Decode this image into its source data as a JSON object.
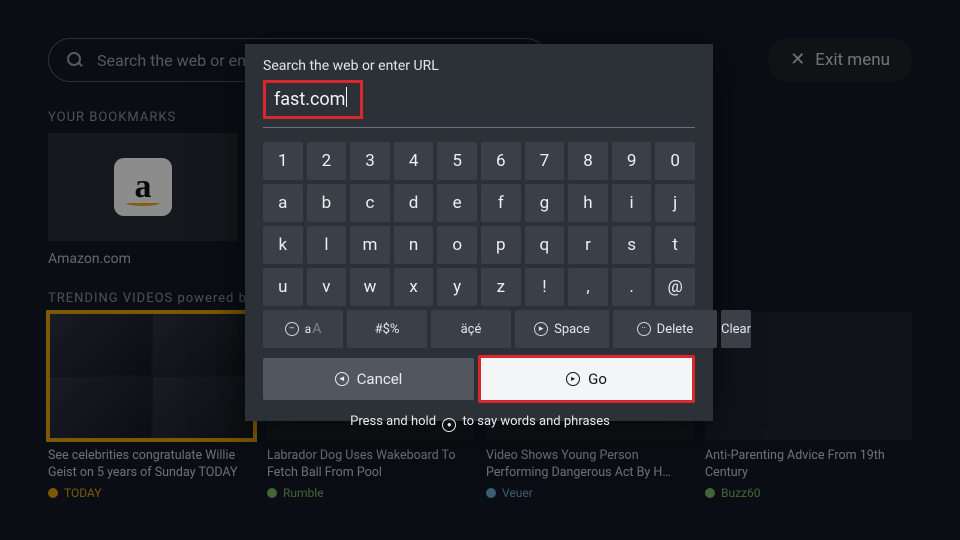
{
  "searchbar": {
    "placeholder": "Search the web or enter URL"
  },
  "exit": {
    "label": "Exit menu"
  },
  "sections": {
    "bookmarks_label": "YOUR BOOKMARKS",
    "trending_label": "TRENDING VIDEOS powered by"
  },
  "bookmarks": [
    {
      "label": "Amazon.com"
    }
  ],
  "trending": [
    {
      "title": "See celebrities congratulate Willie Geist on 5 years of Sunday TODAY",
      "source": "TODAY",
      "color": "#e0a008",
      "highlight": true
    },
    {
      "title": "Labrador Dog Uses Wakeboard To Fetch Ball From Pool",
      "source": "Rumble",
      "color": "#7bb661"
    },
    {
      "title": "Video Shows Young Person Performing Dangerous Act By H…",
      "source": "Veuer",
      "color": "#6aa7d6"
    },
    {
      "title": "Anti-Parenting Advice From 19th Century",
      "source": "Buzz60",
      "color": "#7bb661"
    }
  ],
  "modal": {
    "title": "Search the web or enter URL",
    "input_value": "fast.com",
    "rows": [
      [
        "1",
        "2",
        "3",
        "4",
        "5",
        "6",
        "7",
        "8",
        "9",
        "0"
      ],
      [
        "a",
        "b",
        "c",
        "d",
        "e",
        "f",
        "g",
        "h",
        "i",
        "j"
      ],
      [
        "k",
        "l",
        "m",
        "n",
        "o",
        "p",
        "q",
        "r",
        "s",
        "t"
      ],
      [
        "u",
        "v",
        "w",
        "x",
        "y",
        "z",
        "!",
        ",",
        ".",
        "@"
      ]
    ],
    "fn": {
      "case": "aA",
      "symbols": "#$%",
      "accents": "äçé",
      "space": "Space",
      "delete": "Delete",
      "clear": "Clear"
    },
    "cancel": "Cancel",
    "go": "Go",
    "hint_before": "Press and hold",
    "hint_after": "to say words and phrases"
  }
}
